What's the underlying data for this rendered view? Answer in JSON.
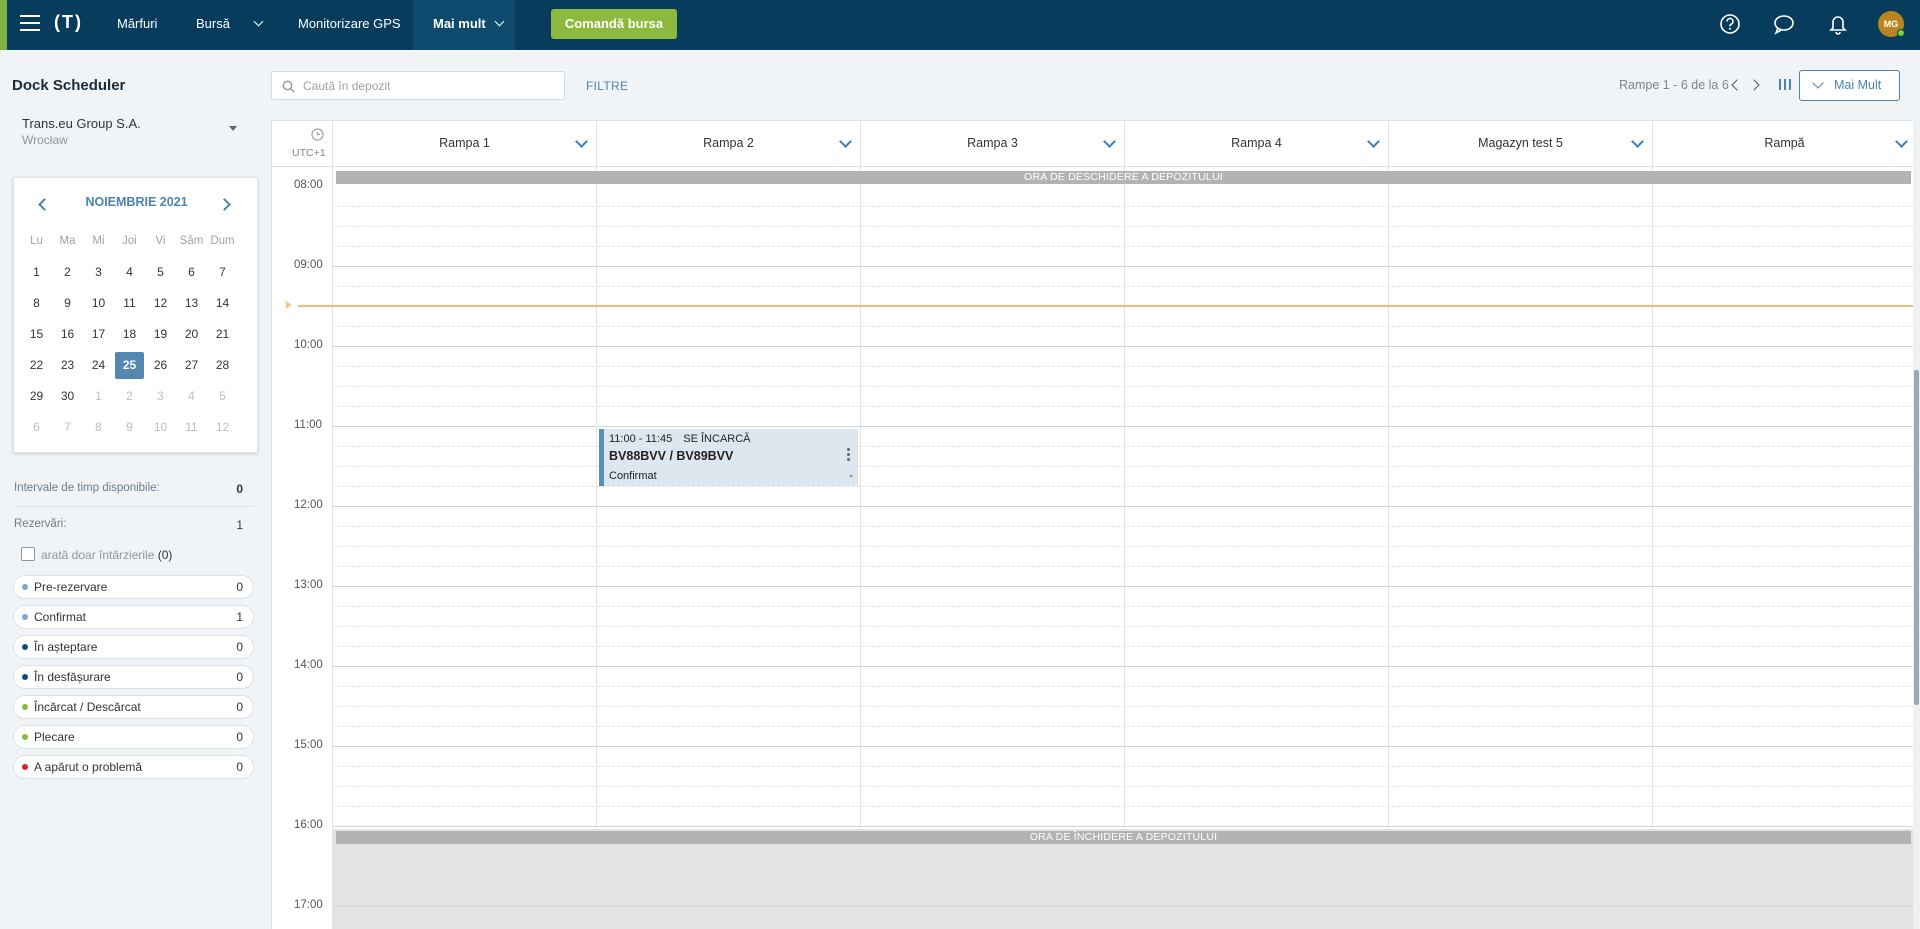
{
  "topbar": {
    "logo": "(T)",
    "nav": [
      "Mărfuri",
      "Bursă",
      "Monitorizare GPS",
      "Mai mult"
    ],
    "order_button": "Comandă bursa",
    "avatar_initials": "MG",
    "brand_color": "#073c5c",
    "accent_color": "#8dba3e"
  },
  "sidebar": {
    "title": "Dock Scheduler",
    "company": "Trans.eu Group S.A.",
    "city": "Wrocław",
    "calendar": {
      "month_label": "NOIEMBRIE 2021",
      "weekdays": [
        "Lu",
        "Ma",
        "Mi",
        "Joi",
        "Vi",
        "Sâm",
        "Dum"
      ],
      "weeks": [
        [
          "1",
          "2",
          "3",
          "4",
          "5",
          "6",
          "7"
        ],
        [
          "8",
          "9",
          "10",
          "11",
          "12",
          "13",
          "14"
        ],
        [
          "15",
          "16",
          "17",
          "18",
          "19",
          "20",
          "21"
        ],
        [
          "22",
          "23",
          "24",
          "25",
          "26",
          "27",
          "28"
        ],
        [
          "29",
          "30",
          "1",
          "2",
          "3",
          "4",
          "5"
        ],
        [
          "6",
          "7",
          "8",
          "9",
          "10",
          "11",
          "12"
        ]
      ],
      "selected_day": "25"
    },
    "available_slots_label": "Intervale de timp disponibile:",
    "available_slots_value": "0",
    "reservations_label": "Rezervări:",
    "reservations_value": "1",
    "only_delays_label": "arată doar întârzierile",
    "only_delays_count": "(0)",
    "statuses": [
      {
        "label": "Pre-rezervare",
        "count": "0",
        "color": "#7fa8c9"
      },
      {
        "label": "Confirmat",
        "count": "1",
        "color": "#7fa8c9"
      },
      {
        "label": "În așteptare",
        "count": "0",
        "color": "#0b4f80"
      },
      {
        "label": "În desfășurare",
        "count": "0",
        "color": "#0b4f80"
      },
      {
        "label": "Încărcat / Descărcat",
        "count": "0",
        "color": "#8dba3e"
      },
      {
        "label": "Plecare",
        "count": "0",
        "color": "#8dba3e"
      },
      {
        "label": "A apărut o problemă",
        "count": "0",
        "color": "#e02020"
      }
    ]
  },
  "toolbar": {
    "search_placeholder": "Caută în depozit",
    "filters": "FILTRE",
    "ramps_range": "Rampe 1 - 6 de la 6",
    "more_button": "Mai Mult"
  },
  "schedule": {
    "timezone": "UTC+1",
    "columns": [
      "Rampa 1",
      "Rampa 2",
      "Rampa 3",
      "Rampa 4",
      "Magazyn test 5",
      "Rampă"
    ],
    "hours": [
      "08:00",
      "09:00",
      "10:00",
      "11:00",
      "12:00",
      "13:00",
      "14:00",
      "15:00",
      "16:00",
      "17:00"
    ],
    "opening_banner": "ORA DE DESCHIDERE A DEPOZITULUI",
    "closing_banner": "ORA DE ÎNCHIDERE A DEPOZITULUI",
    "current_time_color": "#f5a623",
    "booking": {
      "time": "11:00 - 11:45",
      "type": "SE ÎNCARCĂ",
      "plates": "BV88BVV / BV89BVV",
      "status": "Confirmat",
      "extra": "-",
      "ramp": "Rampa 2"
    }
  }
}
